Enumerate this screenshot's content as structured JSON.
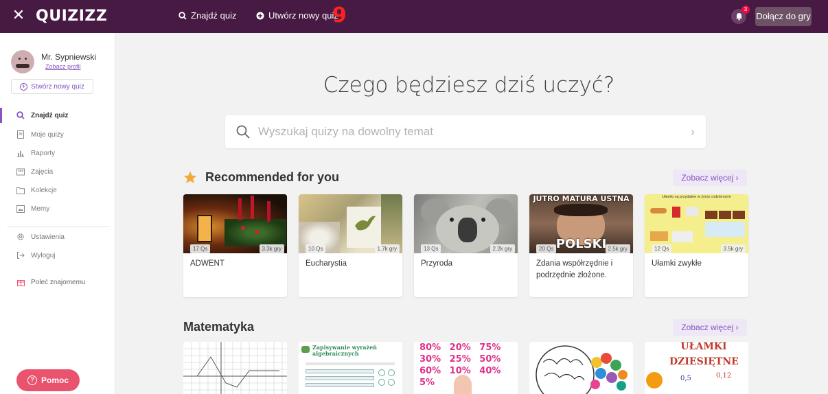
{
  "topbar": {
    "logo": "QUIZIZZ",
    "find_quiz": "Znajdź quiz",
    "create_quiz": "Utwórz nowy quiz",
    "overlay_number": "9",
    "notification_count": "3",
    "join_label": "Dołącz do gry"
  },
  "sidebar": {
    "user_name": "Mr. Sypniewski",
    "profile_link": "Zobacz profil",
    "create_label": "Stwórz nowy quiz",
    "items": [
      {
        "label": "Znajdź quiz",
        "icon": "search-icon"
      },
      {
        "label": "Moje quizy",
        "icon": "document-icon"
      },
      {
        "label": "Raporty",
        "icon": "bar-chart-icon"
      },
      {
        "label": "Zajęcia",
        "icon": "classes-icon"
      },
      {
        "label": "Kolekcje",
        "icon": "folder-icon"
      },
      {
        "label": "Memy",
        "icon": "image-icon"
      },
      {
        "label": "Ustawienia",
        "icon": "gear-icon"
      },
      {
        "label": "Wyloguj",
        "icon": "logout-icon"
      },
      {
        "label": "Poleć znajomemu",
        "icon": "gift-icon"
      }
    ],
    "help_label": "Pomoc"
  },
  "main": {
    "headline": "Czego będziesz dziś uczyć?",
    "search_placeholder": "Wyszukaj quizy na dowolny temat",
    "recommended": {
      "title": "Recommended for you",
      "more": "Zobacz więcej ›",
      "cards": [
        {
          "questions": "17 Qs",
          "plays": "3.3k gry",
          "title": "ADWENT"
        },
        {
          "questions": "10 Qs",
          "plays": "1.7k gry",
          "title": "Eucharystia"
        },
        {
          "questions": "13 Qs",
          "plays": "2.2k gry",
          "title": "Przyroda"
        },
        {
          "questions": "20 Qs",
          "plays": "2.5k gry",
          "title": "Zdania współrzędnie i podrzędnie złożone.",
          "thumb_text": "JUTRO MATURA USTNA",
          "thumb_text2": "POLSKI"
        },
        {
          "questions": "12 Qs",
          "plays": "3.5k gry",
          "title": "Ułamki zwykłe",
          "thumb_text": "Ułamki są przydatne w życiu codziennym"
        }
      ]
    },
    "math": {
      "title": "Matematyka",
      "more": "Zobacz więcej ›",
      "cards": [
        {
          "thumb_text": ""
        },
        {
          "thumb_text": "Zapisywanie wyrażeń algebraicznych"
        },
        {
          "thumb_text": "80% 20% 75% 30% 25% 50% 60% 10% 40% 5%"
        },
        {
          "thumb_text": ""
        },
        {
          "thumb_text": "UŁAMKI DZIESIĘTNE",
          "thumb_text2": "0,5",
          "thumb_text3": "0,12"
        }
      ]
    }
  },
  "colors": {
    "topbar": "#461a42",
    "accent": "#8854c0",
    "help": "#e9536d",
    "star": "#f2a93b"
  }
}
